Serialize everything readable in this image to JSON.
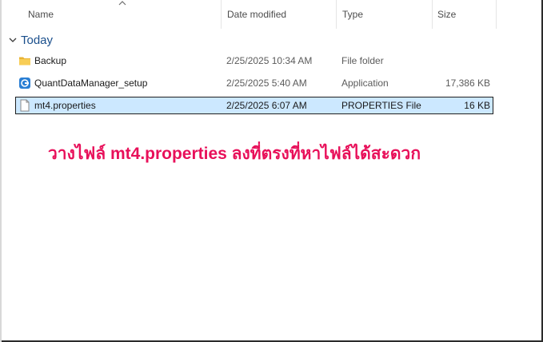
{
  "columns": {
    "name": "Name",
    "date": "Date modified",
    "type": "Type",
    "size": "Size"
  },
  "group": {
    "label": "Today"
  },
  "files": [
    {
      "name": "Backup",
      "date": "2/25/2025 10:34 AM",
      "type": "File folder",
      "size": "",
      "icon": "folder-icon",
      "selected": false
    },
    {
      "name": "QuantDataManager_setup",
      "date": "2/25/2025 5:40 AM",
      "type": "Application",
      "size": "17,386 KB",
      "icon": "application-icon",
      "selected": false
    },
    {
      "name": "mt4.properties",
      "date": "2/25/2025 6:07 AM",
      "type": "PROPERTIES File",
      "size": "16 KB",
      "icon": "file-icon",
      "selected": true
    }
  ],
  "annotation": {
    "text": "วางไฟล์ mt4.properties ลงที่ตรงที่หาไฟล์ได้สะดวก",
    "color": "#e8105a"
  },
  "colors": {
    "selection": "#cce8ff",
    "group_text": "#1a4f8c",
    "folder": "#f5c342"
  }
}
